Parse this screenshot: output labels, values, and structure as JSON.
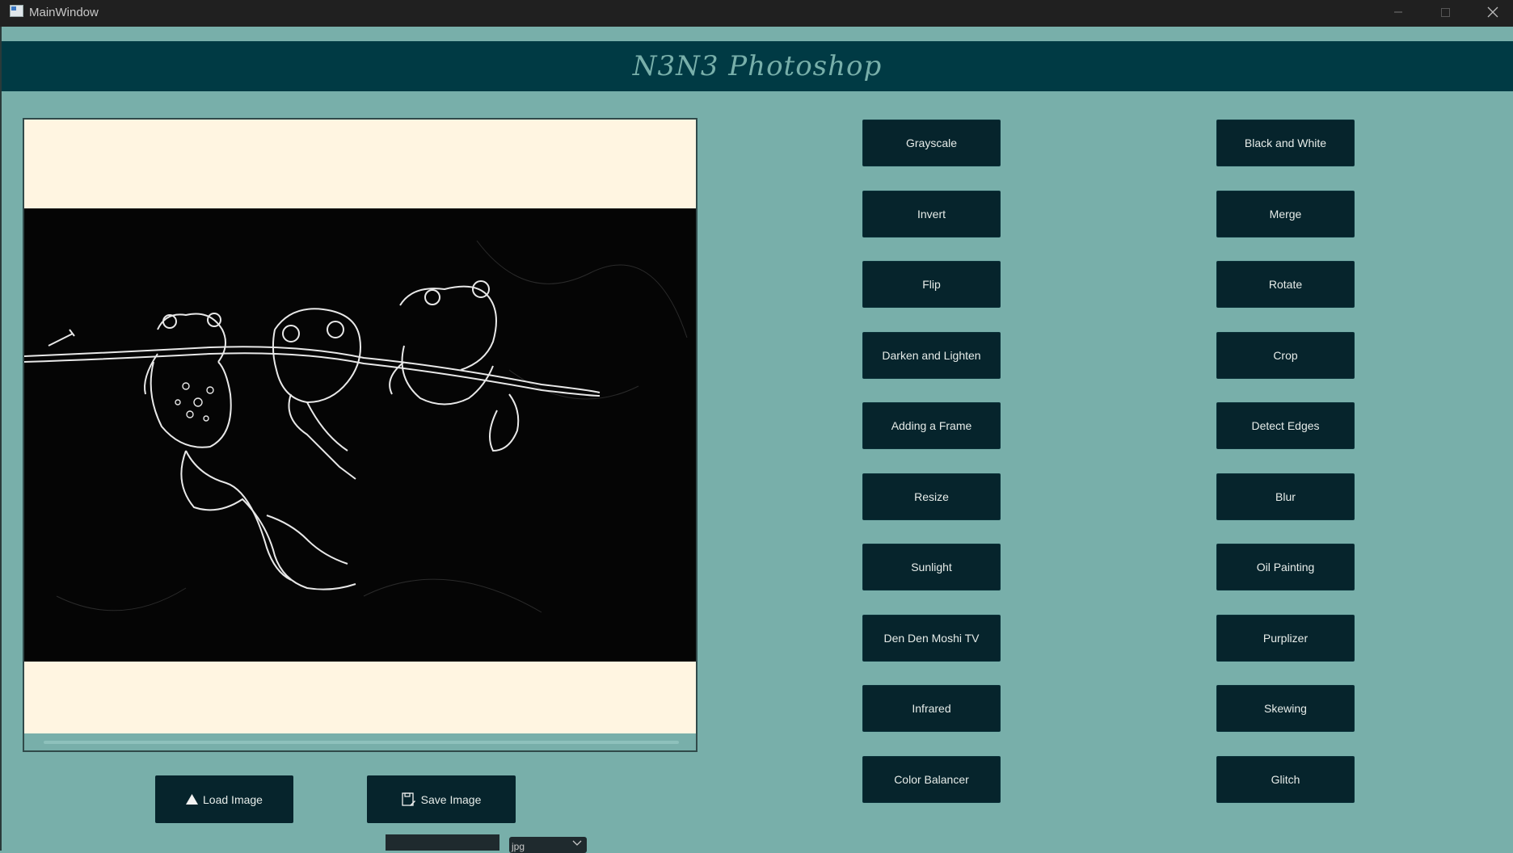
{
  "window": {
    "title": "MainWindow"
  },
  "app": {
    "title": "N3N3 Photoshop"
  },
  "filters_left": [
    "Grayscale",
    "Invert",
    "Flip",
    "Darken and Lighten",
    "Adding a Frame",
    "Resize",
    "Sunlight",
    "Den Den Moshi TV",
    "Infrared",
    "Color Balancer"
  ],
  "filters_right": [
    "Black and White",
    "Merge",
    "Rotate",
    "Crop",
    "Detect Edges",
    "Blur",
    "Oil Painting",
    "Purplizer",
    "Skewing",
    "Glitch"
  ],
  "actions": {
    "load": "Load Image",
    "save": "Save Image"
  },
  "format_select": {
    "value": "jpg"
  },
  "icons": {
    "load": "upload-triangle-icon",
    "save": "save-disk-icon",
    "app": "window-app-icon"
  },
  "colors": {
    "background": "#78afaa",
    "banner": "#003a44",
    "button": "#06242c",
    "canvas_bg": "#fff5e1"
  }
}
